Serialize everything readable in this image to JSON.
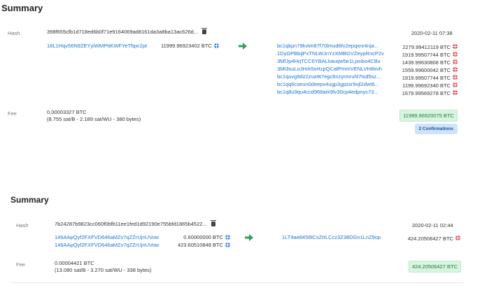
{
  "tx1": {
    "title": "Summary",
    "hash_label": "Hash",
    "hash": "398f655cfb1d718ed6b0f71e9164069ad8161da3a8ba13ac626d...",
    "date": "2020-02-11 07:38",
    "inputs": [
      {
        "address": "18L1Hqv56N9ZEYyiWMPttKWFYeTfqxr2pt",
        "amount": "11999.96923402 BTC"
      }
    ],
    "outputs": [
      {
        "address": "bc1qkpn79kvtm87f70lmud6fv2epqxnr4nja...",
        "amount": "2279.99412119 BTC"
      },
      {
        "address": "1DyGPBbijPxTNLWJnYzXMBGVZeypRncP2v",
        "amount": "1919.99507744 BTC"
      },
      {
        "address": "3MfJp4HqTCC6YBALkauqw5e1Ljxnbo4CBx",
        "amount": "1439.99630808 BTC"
      },
      {
        "address": "3Mt3suLoJHrk5xHzpQCafPmmVENLVH8xvh",
        "amount": "1559.99600042 BTC"
      },
      {
        "address": "bc1quvg9dz2zua9t7egc6nzyrmruhl7tsd5sz...",
        "amount": "1919.99507744 BTC"
      },
      {
        "address": "bc1qq6cseun0deepx4ugp3gpsxr9vjl2dwt6...",
        "amount": "1199.99692340 BTC"
      },
      {
        "address": "bc1q8u9qu4ccd968ark9lv30cp4edpnyc73...",
        "amount": "1679.99569278 BTC"
      }
    ],
    "fee_label": "Fee",
    "fee_btc": "0.00003327 BTC",
    "fee_detail": "(8.755 sat/B - 2.189 sat/WU - 380 bytes)",
    "total": "11999.96920075 BTC",
    "confirmations": "2 Confirmations"
  },
  "tx2": {
    "title": "Summary",
    "hash_label": "Hash",
    "hash": "7b24287b9823cc060f0bfb11ee1fed1d92190e755bfd1865b4522...",
    "date": "2020-02-11 02:44",
    "inputs": [
      {
        "address": "146AApQyf2FXFVD646aMZv7qZZrUjnUVow",
        "amount": "0.60000000 BTC"
      },
      {
        "address": "146AApQyf2FXFVD646aMZv7qZZrUjnUVow",
        "amount": "423.60510848 BTC"
      }
    ],
    "outputs": [
      {
        "address": "1LT4ae8458tCsZtrLCcz3Z38DGn1LnZ9op",
        "amount": "424.20506427 BTC"
      }
    ],
    "fee_label": "Fee",
    "fee_btc": "0.00004421 BTC",
    "fee_detail": "(13.080 sat/B - 3.270 sat/WU - 338 bytes)",
    "total": "424.20506427 BTC"
  },
  "icons": {
    "input_globe_color": "#3b82f6",
    "output_globe_color": "#e5484d",
    "arrow_color": "#2e9e5b",
    "badge_green_bg": "#d7f5df",
    "badge_blue_bg": "#cfe3fa"
  }
}
